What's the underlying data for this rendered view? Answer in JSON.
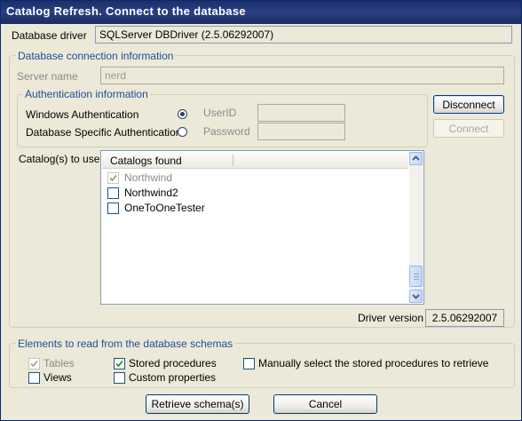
{
  "window": {
    "title": "Catalog Refresh. Connect to the database"
  },
  "driver": {
    "label": "Database driver",
    "value": "SQLServer DBDriver (2.5.06292007)"
  },
  "connection": {
    "legend": "Database connection information",
    "server_label": "Server name",
    "server_value": "nerd",
    "auth": {
      "legend": "Authentication information",
      "windows_label": "Windows Authentication",
      "db_label": "Database Specific Authentication",
      "selected": "windows",
      "userid_label": "UserID",
      "userid_value": "",
      "password_label": "Password",
      "password_value": ""
    },
    "disconnect_label": "Disconnect",
    "connect_label": "Connect"
  },
  "catalogs": {
    "label": "Catalog(s) to use",
    "column_header": "Catalogs found",
    "items": [
      {
        "name": "Northwind",
        "checked": true,
        "disabled": true
      },
      {
        "name": "Northwind2",
        "checked": false,
        "disabled": false
      },
      {
        "name": "OneToOneTester",
        "checked": false,
        "disabled": false
      }
    ]
  },
  "driver_version": {
    "label": "Driver version",
    "value": "2.5.06292007"
  },
  "elements": {
    "legend": "Elements to read from the database schemas",
    "tables_label": "Tables",
    "views_label": "Views",
    "stored_label": "Stored procedures",
    "custom_label": "Custom properties",
    "manual_label": "Manually select the stored procedures to retrieve",
    "tables_checked": true,
    "views_checked": false,
    "stored_checked": true,
    "custom_checked": false,
    "manual_checked": false
  },
  "buttons": {
    "retrieve_label": "Retrieve schema(s)",
    "cancel_label": "Cancel"
  },
  "icons": {
    "check": "check-icon",
    "scroll_up": "scroll-up-arrow-icon",
    "scroll_down": "scroll-down-arrow-icon"
  },
  "colors": {
    "title_bar": "#1c2f6a",
    "group_legend": "#1b4f9a",
    "dialog_bg": "#ece9d8",
    "disabled_text": "#8a8a8a"
  }
}
